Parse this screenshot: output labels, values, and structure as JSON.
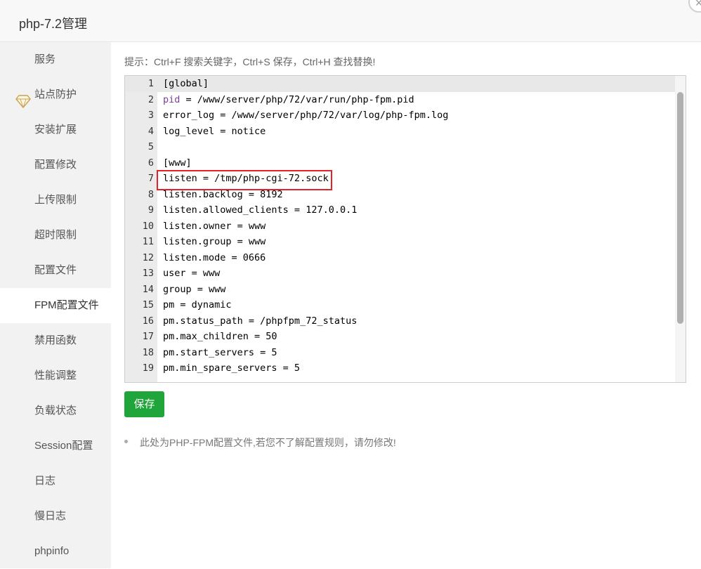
{
  "dialog": {
    "title": "php-7.2管理",
    "close_symbol": "×"
  },
  "sidebar": {
    "items": [
      {
        "label": "服务"
      },
      {
        "label": "站点防护",
        "icon": "diamond-icon"
      },
      {
        "label": "安装扩展"
      },
      {
        "label": "配置修改"
      },
      {
        "label": "上传限制"
      },
      {
        "label": "超时限制"
      },
      {
        "label": "配置文件"
      },
      {
        "label": "FPM配置文件",
        "active": true
      },
      {
        "label": "禁用函数"
      },
      {
        "label": "性能调整"
      },
      {
        "label": "负载状态"
      },
      {
        "label": "Session配置"
      },
      {
        "label": "日志"
      },
      {
        "label": "慢日志"
      },
      {
        "label": "phpinfo"
      }
    ]
  },
  "main": {
    "hint": "提示：Ctrl+F 搜索关键字，Ctrl+S 保存，Ctrl+H 查找替换!",
    "editor_lines": [
      {
        "num": "1",
        "text": "[global]",
        "active": true
      },
      {
        "num": "2",
        "key": "pid",
        "rest": " = /www/server/php/72/var/run/php-fpm.pid"
      },
      {
        "num": "3",
        "text": "error_log = /www/server/php/72/var/log/php-fpm.log"
      },
      {
        "num": "4",
        "text": "log_level = notice"
      },
      {
        "num": "5",
        "text": ""
      },
      {
        "num": "6",
        "text": "[www]"
      },
      {
        "num": "7",
        "text": "listen = /tmp/php-cgi-72.sock"
      },
      {
        "num": "8",
        "text": "listen.backlog = 8192"
      },
      {
        "num": "9",
        "text": "listen.allowed_clients = 127.0.0.1"
      },
      {
        "num": "10",
        "text": "listen.owner = www"
      },
      {
        "num": "11",
        "text": "listen.group = www"
      },
      {
        "num": "12",
        "text": "listen.mode = 0666"
      },
      {
        "num": "13",
        "text": "user = www"
      },
      {
        "num": "14",
        "text": "group = www"
      },
      {
        "num": "15",
        "text": "pm = dynamic"
      },
      {
        "num": "16",
        "text": "pm.status_path = /phpfpm_72_status"
      },
      {
        "num": "17",
        "text": "pm.max_children = 50"
      },
      {
        "num": "18",
        "text": "pm.start_servers = 5"
      },
      {
        "num": "19",
        "text": "pm.min_spare_servers = 5"
      }
    ],
    "save_label": "保存",
    "note": "此处为PHP-FPM配置文件,若您不了解配置规则，请勿修改!"
  },
  "colors": {
    "accent_green": "#20a53a",
    "highlight_red": "#e0232a",
    "keyword_purple": "#7a3e9d"
  }
}
